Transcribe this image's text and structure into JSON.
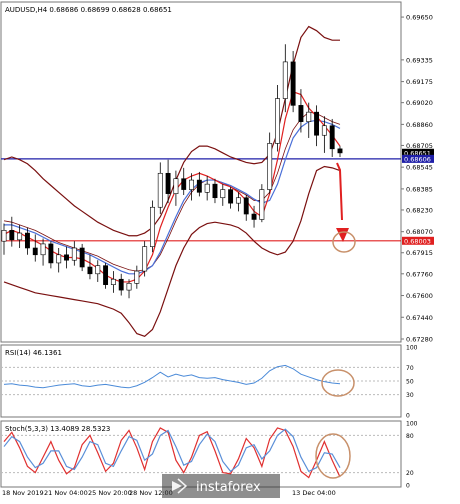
{
  "chart_data": [
    {
      "type": "candlestick",
      "symbol_line": "AUDUSD,H4  0.68686 0.68699 0.68628 0.68651",
      "y_ticks": [
        "0.69650",
        "0.69335",
        "0.69175",
        "0.69020",
        "0.68860",
        "0.68705",
        "0.68545",
        "0.68385",
        "0.68230",
        "0.68070",
        "0.67915",
        "0.67760",
        "0.67600",
        "0.67440",
        "0.67280"
      ],
      "ylim": [
        0.6728,
        0.6968
      ],
      "price_labels": [
        {
          "text": "0.68651",
          "value": 0.68651,
          "color": "#000000"
        },
        {
          "text": "0.68606",
          "value": 0.68606,
          "color": "#1f1fa8"
        },
        {
          "text": "0.68003",
          "value": 0.68003,
          "color": "#e02020"
        }
      ],
      "horizontal_lines": [
        {
          "value": 0.68606,
          "color": "#1f1fa8"
        },
        {
          "value": 0.68003,
          "color": "#e02020"
        }
      ],
      "bollinger": {
        "upper": [
          0.686,
          0.6862,
          0.686,
          0.6857,
          0.6852,
          0.6846,
          0.6841,
          0.6836,
          0.6831,
          0.6826,
          0.6822,
          0.6818,
          0.6814,
          0.6811,
          0.6808,
          0.6806,
          0.6804,
          0.6804,
          0.6806,
          0.681,
          0.6818,
          0.683,
          0.6845,
          0.6858,
          0.6866,
          0.687,
          0.687,
          0.6868,
          0.6865,
          0.6862,
          0.686,
          0.6858,
          0.6857,
          0.6858,
          0.6864,
          0.688,
          0.6905,
          0.693,
          0.695,
          0.6958,
          0.6955,
          0.695,
          0.6948,
          0.6948
        ],
        "middle": [
          0.6815,
          0.6814,
          0.6812,
          0.681,
          0.6808,
          0.6805,
          0.6802,
          0.6799,
          0.6797,
          0.6795,
          0.6793,
          0.6791,
          0.6789,
          0.6786,
          0.6783,
          0.6781,
          0.6779,
          0.6778,
          0.6779,
          0.6782,
          0.679,
          0.6802,
          0.6815,
          0.6827,
          0.6836,
          0.6842,
          0.6845,
          0.6845,
          0.6843,
          0.684,
          0.6837,
          0.6834,
          0.683,
          0.683,
          0.6836,
          0.685,
          0.6868,
          0.6882,
          0.689,
          0.6895,
          0.6894,
          0.6891,
          0.6888,
          0.6886
        ],
        "lower": [
          0.677,
          0.6768,
          0.6766,
          0.6764,
          0.6762,
          0.6761,
          0.676,
          0.6759,
          0.6758,
          0.6757,
          0.6756,
          0.6755,
          0.6754,
          0.6752,
          0.675,
          0.6747,
          0.674,
          0.6732,
          0.673,
          0.6735,
          0.6748,
          0.6765,
          0.6782,
          0.6795,
          0.6805,
          0.681,
          0.6813,
          0.6814,
          0.6813,
          0.6812,
          0.681,
          0.6806,
          0.68,
          0.6795,
          0.6792,
          0.679,
          0.6792,
          0.68,
          0.6815,
          0.6835,
          0.6852,
          0.6855,
          0.6854,
          0.6852
        ]
      },
      "ma_fast": [
        0.6805,
        0.6808,
        0.6806,
        0.6803,
        0.68,
        0.6797,
        0.6793,
        0.679,
        0.6788,
        0.6788,
        0.6787,
        0.6784,
        0.678,
        0.6775,
        0.6772,
        0.677,
        0.677,
        0.6772,
        0.6778,
        0.679,
        0.681,
        0.6825,
        0.6838,
        0.6845,
        0.6848,
        0.685,
        0.6848,
        0.6845,
        0.6842,
        0.684,
        0.6836,
        0.683,
        0.6822,
        0.6818,
        0.6835,
        0.686,
        0.689,
        0.691,
        0.6908,
        0.6898,
        0.6892,
        0.6885,
        0.6878,
        0.687
      ],
      "ma_slow": [
        0.6812,
        0.6812,
        0.681,
        0.6808,
        0.6806,
        0.6803,
        0.68,
        0.6798,
        0.6796,
        0.6794,
        0.6792,
        0.679,
        0.6787,
        0.6784,
        0.6781,
        0.6778,
        0.6776,
        0.6776,
        0.6778,
        0.6782,
        0.6792,
        0.6805,
        0.6818,
        0.683,
        0.6838,
        0.6843,
        0.6845,
        0.6845,
        0.6843,
        0.6841,
        0.6838,
        0.6835,
        0.6831,
        0.6828,
        0.683,
        0.6842,
        0.686,
        0.6876,
        0.6884,
        0.6888,
        0.6889,
        0.6888,
        0.6886,
        0.6883
      ],
      "candles": [
        [
          0.68,
          0.6813,
          0.679,
          0.6808
        ],
        [
          0.6808,
          0.6818,
          0.6796,
          0.6801
        ],
        [
          0.6801,
          0.6812,
          0.6795,
          0.6806
        ],
        [
          0.6806,
          0.681,
          0.679,
          0.6795
        ],
        [
          0.6795,
          0.6805,
          0.6785,
          0.679
        ],
        [
          0.679,
          0.6802,
          0.6782,
          0.6798
        ],
        [
          0.6798,
          0.68,
          0.678,
          0.6784
        ],
        [
          0.6784,
          0.6795,
          0.6777,
          0.679
        ],
        [
          0.679,
          0.6796,
          0.678,
          0.6786
        ],
        [
          0.6786,
          0.68,
          0.6782,
          0.6795
        ],
        [
          0.6795,
          0.6798,
          0.6778,
          0.6781
        ],
        [
          0.6781,
          0.679,
          0.6772,
          0.6776
        ],
        [
          0.6776,
          0.6786,
          0.677,
          0.6782
        ],
        [
          0.6782,
          0.6784,
          0.6765,
          0.6768
        ],
        [
          0.6768,
          0.6778,
          0.6762,
          0.6772
        ],
        [
          0.6772,
          0.6776,
          0.676,
          0.6764
        ],
        [
          0.6764,
          0.6772,
          0.6758,
          0.6769
        ],
        [
          0.6769,
          0.6782,
          0.6765,
          0.6778
        ],
        [
          0.6778,
          0.68,
          0.6774,
          0.6796
        ],
        [
          0.6796,
          0.683,
          0.6792,
          0.6825
        ],
        [
          0.6825,
          0.6858,
          0.682,
          0.685
        ],
        [
          0.685,
          0.686,
          0.6828,
          0.6835
        ],
        [
          0.6835,
          0.6852,
          0.6826,
          0.6846
        ],
        [
          0.6846,
          0.6854,
          0.6834,
          0.6838
        ],
        [
          0.6838,
          0.685,
          0.683,
          0.6845
        ],
        [
          0.6845,
          0.6851,
          0.6833,
          0.6836
        ],
        [
          0.6836,
          0.6848,
          0.683,
          0.6842
        ],
        [
          0.6842,
          0.6846,
          0.6828,
          0.6832
        ],
        [
          0.6832,
          0.6842,
          0.6826,
          0.6838
        ],
        [
          0.6838,
          0.684,
          0.6824,
          0.6828
        ],
        [
          0.6828,
          0.6836,
          0.6822,
          0.6832
        ],
        [
          0.6832,
          0.6834,
          0.6815,
          0.682
        ],
        [
          0.682,
          0.6826,
          0.681,
          0.6816
        ],
        [
          0.6816,
          0.6842,
          0.6814,
          0.6838
        ],
        [
          0.6838,
          0.688,
          0.6835,
          0.6872
        ],
        [
          0.6872,
          0.6915,
          0.6866,
          0.6905
        ],
        [
          0.6905,
          0.6945,
          0.6895,
          0.6932
        ],
        [
          0.6932,
          0.694,
          0.6895,
          0.69
        ],
        [
          0.69,
          0.6912,
          0.688,
          0.6888
        ],
        [
          0.6888,
          0.6902,
          0.6876,
          0.6895
        ],
        [
          0.6895,
          0.69,
          0.687,
          0.6878
        ],
        [
          0.6878,
          0.6892,
          0.6865,
          0.6885
        ],
        [
          0.6885,
          0.689,
          0.6862,
          0.6868
        ],
        [
          0.6868,
          0.687,
          0.6862,
          0.6865
        ]
      ]
    },
    {
      "type": "line",
      "label": "RSI(14) 46.1361",
      "ylim": [
        0,
        100
      ],
      "levels": [
        70,
        50,
        30
      ],
      "y_ticks": [
        "100",
        "70",
        "50",
        "30",
        "0"
      ],
      "values": [
        45,
        46,
        44,
        43,
        41,
        40,
        42,
        44,
        45,
        46,
        43,
        42,
        44,
        45,
        43,
        41,
        40,
        43,
        48,
        55,
        63,
        56,
        60,
        57,
        59,
        55,
        54,
        55,
        52,
        50,
        48,
        45,
        47,
        54,
        65,
        71,
        73,
        68,
        60,
        56,
        52,
        49,
        47,
        46
      ]
    },
    {
      "type": "line",
      "label": "Stoch(5,3,3) 13.4089 28.5323",
      "ylim": [
        0,
        100
      ],
      "levels": [
        80,
        20
      ],
      "y_ticks": [
        "100",
        "80",
        "20",
        "0"
      ],
      "series": [
        {
          "color": "#e03030",
          "values": [
            70,
            85,
            60,
            30,
            20,
            45,
            70,
            40,
            18,
            28,
            65,
            80,
            52,
            22,
            35,
            72,
            88,
            60,
            25,
            70,
            92,
            85,
            40,
            20,
            45,
            80,
            86,
            55,
            20,
            18,
            42,
            75,
            60,
            30,
            74,
            92,
            88,
            62,
            22,
            12,
            40,
            70,
            40,
            13
          ]
        },
        {
          "color": "#5a8fd8",
          "values": [
            62,
            78,
            70,
            45,
            28,
            35,
            55,
            55,
            30,
            25,
            45,
            70,
            65,
            35,
            30,
            55,
            78,
            72,
            40,
            50,
            80,
            88,
            62,
            32,
            38,
            65,
            82,
            70,
            38,
            22,
            32,
            60,
            65,
            42,
            55,
            80,
            90,
            78,
            45,
            22,
            28,
            52,
            50,
            28
          ]
        }
      ]
    }
  ],
  "time_axis": [
    "18 Nov 2019",
    "21 Nov 04:00",
    "25 Nov 20:00",
    "28 Nov 12:00",
    "13 Dec 04:00"
  ],
  "watermark": "instaforex"
}
